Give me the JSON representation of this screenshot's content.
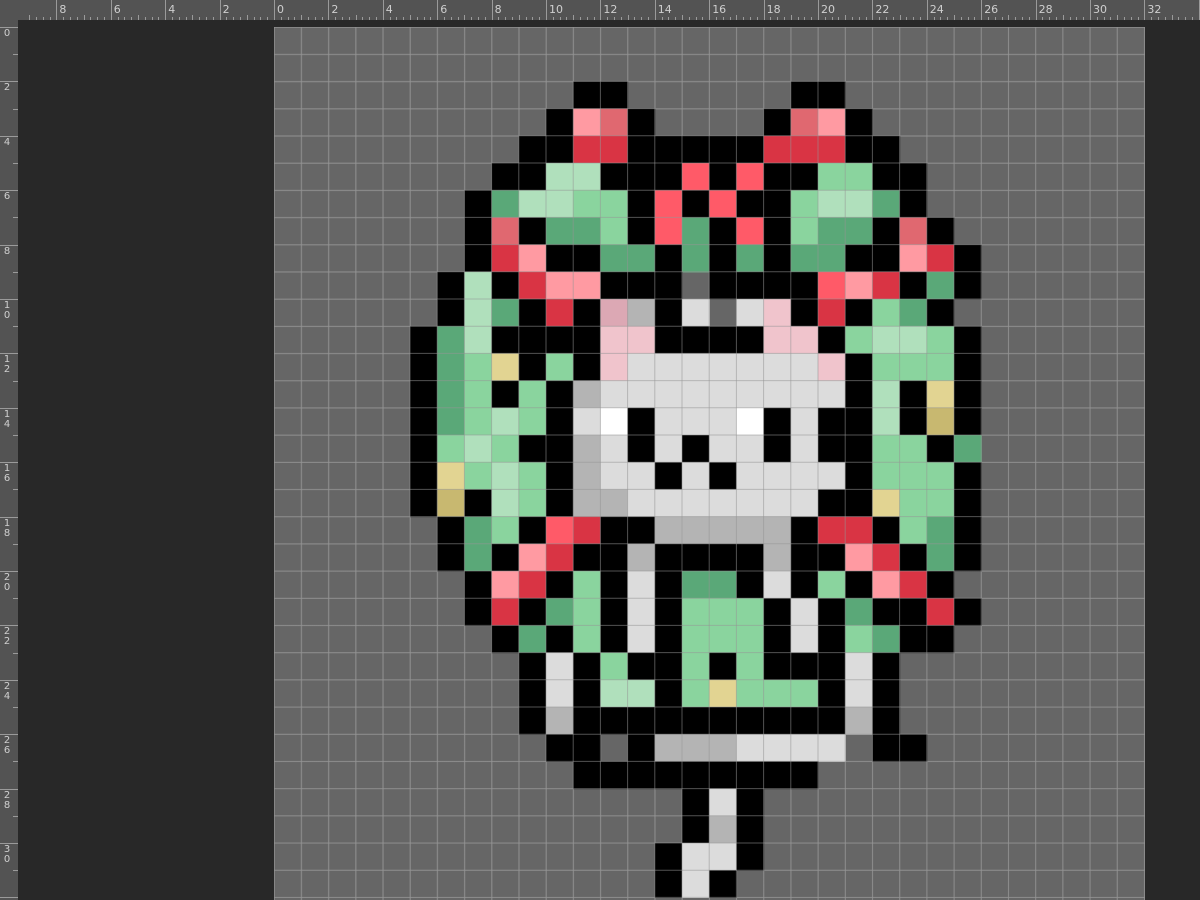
{
  "app": {
    "ruler_top_labels": [
      "8",
      "6",
      "4",
      "2",
      "0",
      "2",
      "4",
      "6",
      "8",
      "10",
      "12",
      "14",
      "16",
      "18",
      "20",
      "22",
      "24",
      "26",
      "28",
      "30",
      "32"
    ],
    "ruler_left_labels": [
      "0",
      "2",
      "4",
      "6",
      "8",
      "1\n0",
      "1\n2",
      "1\n4",
      "1\n6",
      "1\n8",
      "2\n0",
      "2\n2",
      "2\n4",
      "2\n6",
      "2\n8",
      "3\n0"
    ]
  },
  "canvas": {
    "grid_columns": 32,
    "grid_rows": 32,
    "background_color": "#666666",
    "grid_line_color": "#969696"
  },
  "palette": {
    "K": "#000000",
    "R": "#d93444",
    "r": "#ff5a68",
    "P": "#ff9aa2",
    "s": "#e06870",
    "G": "#5aa878",
    "g": "#8ad49e",
    "l": "#b0e0bc",
    "Y": "#e2d492",
    "y": "#c8b870",
    "W": "#ffffff",
    "w": "#dcdcdc",
    "q": "#b4b4b4",
    "k": "#f0c4cc",
    "p": "#dca8b4"
  },
  "pixel_art": [
    "................................",
    "................................",
    "...........KK......KK...........",
    "..........KPsK....KsPK..........",
    ".........KKRRKKKKKRRRKK.........",
    "........KKllKKKrKrKKggKK........",
    ".......KGllggKrKrKKgllGK........",
    ".......KsKGGgKrGKrKgGGKsK.......",
    ".......KRPKKGGKGKGKGGKKPRK......",
    "......KlKRPPKKK.KKKKrPRKGK......",
    "......KlGKRKpqKw.wkKRKgGK.......",
    ".....KGlKKKKkkKKKKkkKgllgK......",
    ".....KGgYKgKkwwwwwwwkKgggK......",
    ".....KGgKgKqwwwwwwwwwKlKYK......",
    ".....KGglgKwWKwwwWKwKKlKyK......",
    ".....KglgKKqwKwKwwKwKKggKG......",
    ".....KYglgKqwwKwKwwwwKgggK......",
    ".....KyKlgKqqwwwwwwwKKYggK......",
    "......KGgKrRKKqqqqqKRRKgGK......",
    "......KGKPRKKqKKKKqKKPRKGK......",
    ".......KPRKgKwKGGKwKgKPRK.......",
    ".......KRKGgKwKgggKwKGKKRK......",
    "........KGKgKwKgggKwKgGKK.......",
    ".........KwKgKKgKgKKKwK.........",
    ".........KwKllKgYgggKwK.........",
    ".........KqKKKKKKKKKKqK.........",
    "..........KK.Kqqqwwww.KK........",
    "...........KKKKKKKKK............",
    "...............KwK..............",
    "...............KqK..............",
    "..............KwwK..............",
    "..............KwK..............."
  ]
}
